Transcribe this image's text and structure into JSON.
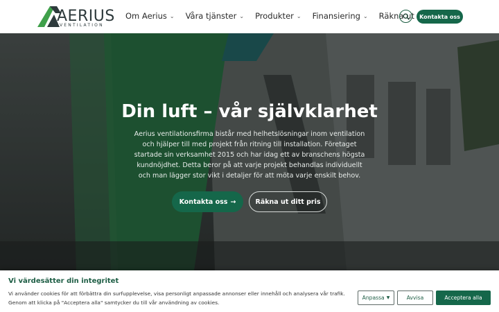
{
  "brand": {
    "logo_word": "AERIUS",
    "logo_sub": "VENTILATION",
    "colors": {
      "primary": "#15674a",
      "accent": "#3fa04a"
    }
  },
  "nav": {
    "items": [
      {
        "label": "Om Aerius",
        "has_dropdown": true
      },
      {
        "label": "Våra tjänster",
        "has_dropdown": true
      },
      {
        "label": "Produkter",
        "has_dropdown": true
      },
      {
        "label": "Finansiering",
        "has_dropdown": true
      },
      {
        "label": "Räkna ut ditt pris",
        "has_dropdown": false
      }
    ],
    "search_icon": "search-icon",
    "cta_label": "Kontakta oss"
  },
  "hero": {
    "title": "Din luft – vår självklarhet",
    "text": "Aerius ventilationsfirma bistår med helhetslösningar inom ventilation och hjälper till med projekt från ritning till installation. Företaget startade sin verksamhet 2015 och har idag ett av branschens högsta kundnöjdhet. Detta beror på att varje projekt behandlas individuellt och man lägger stor vikt i detaljer för att möta varje enskilt behov.",
    "primary_button": "Kontakta oss",
    "primary_button_icon": "arrow-right-icon",
    "secondary_button": "Räkna ut ditt pris"
  },
  "cookie": {
    "title": "Vi värdesätter din integritet",
    "text": "Vi använder cookies för att förbättra din surfupplevelse, visa personligt anpassade annonser eller innehåll och analysera vår trafik. Genom att klicka på \"Acceptera alla\" samtycker du till vår användning av cookies.",
    "customize_label": "Anpassa",
    "reject_label": "Avvisa",
    "accept_label": "Acceptera alla"
  }
}
